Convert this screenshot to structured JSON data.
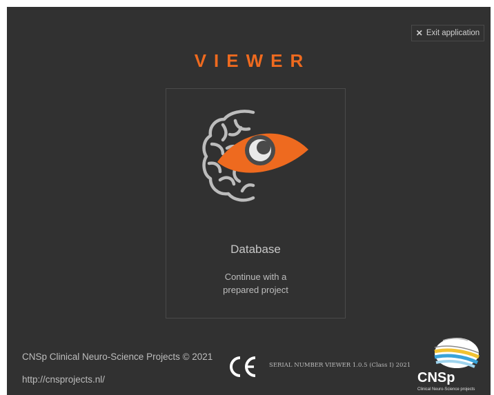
{
  "app": {
    "title": "VIEWER",
    "exit_label": "Exit application",
    "exit_glyph": "✕"
  },
  "card": {
    "title": "Database",
    "description_line1": "Continue with a",
    "description_line2": "prepared project",
    "icon": "brain-eye-icon"
  },
  "footer": {
    "copyright": "CNSp Clinical Neuro-Science Projects © 2021",
    "url": "http://cnsprojects.nl/",
    "ce_mark": "CE",
    "serial": "SERIAL NUMBER VIEWER 1.0.5 (Class I) 2021",
    "logo_text": "CNSp",
    "logo_subtext": "Clinical Neuro-Science projects"
  },
  "colors": {
    "background": "#313131",
    "accent": "#ee6a1f",
    "border": "#4a4a4a",
    "text": "#bdbdbd"
  }
}
